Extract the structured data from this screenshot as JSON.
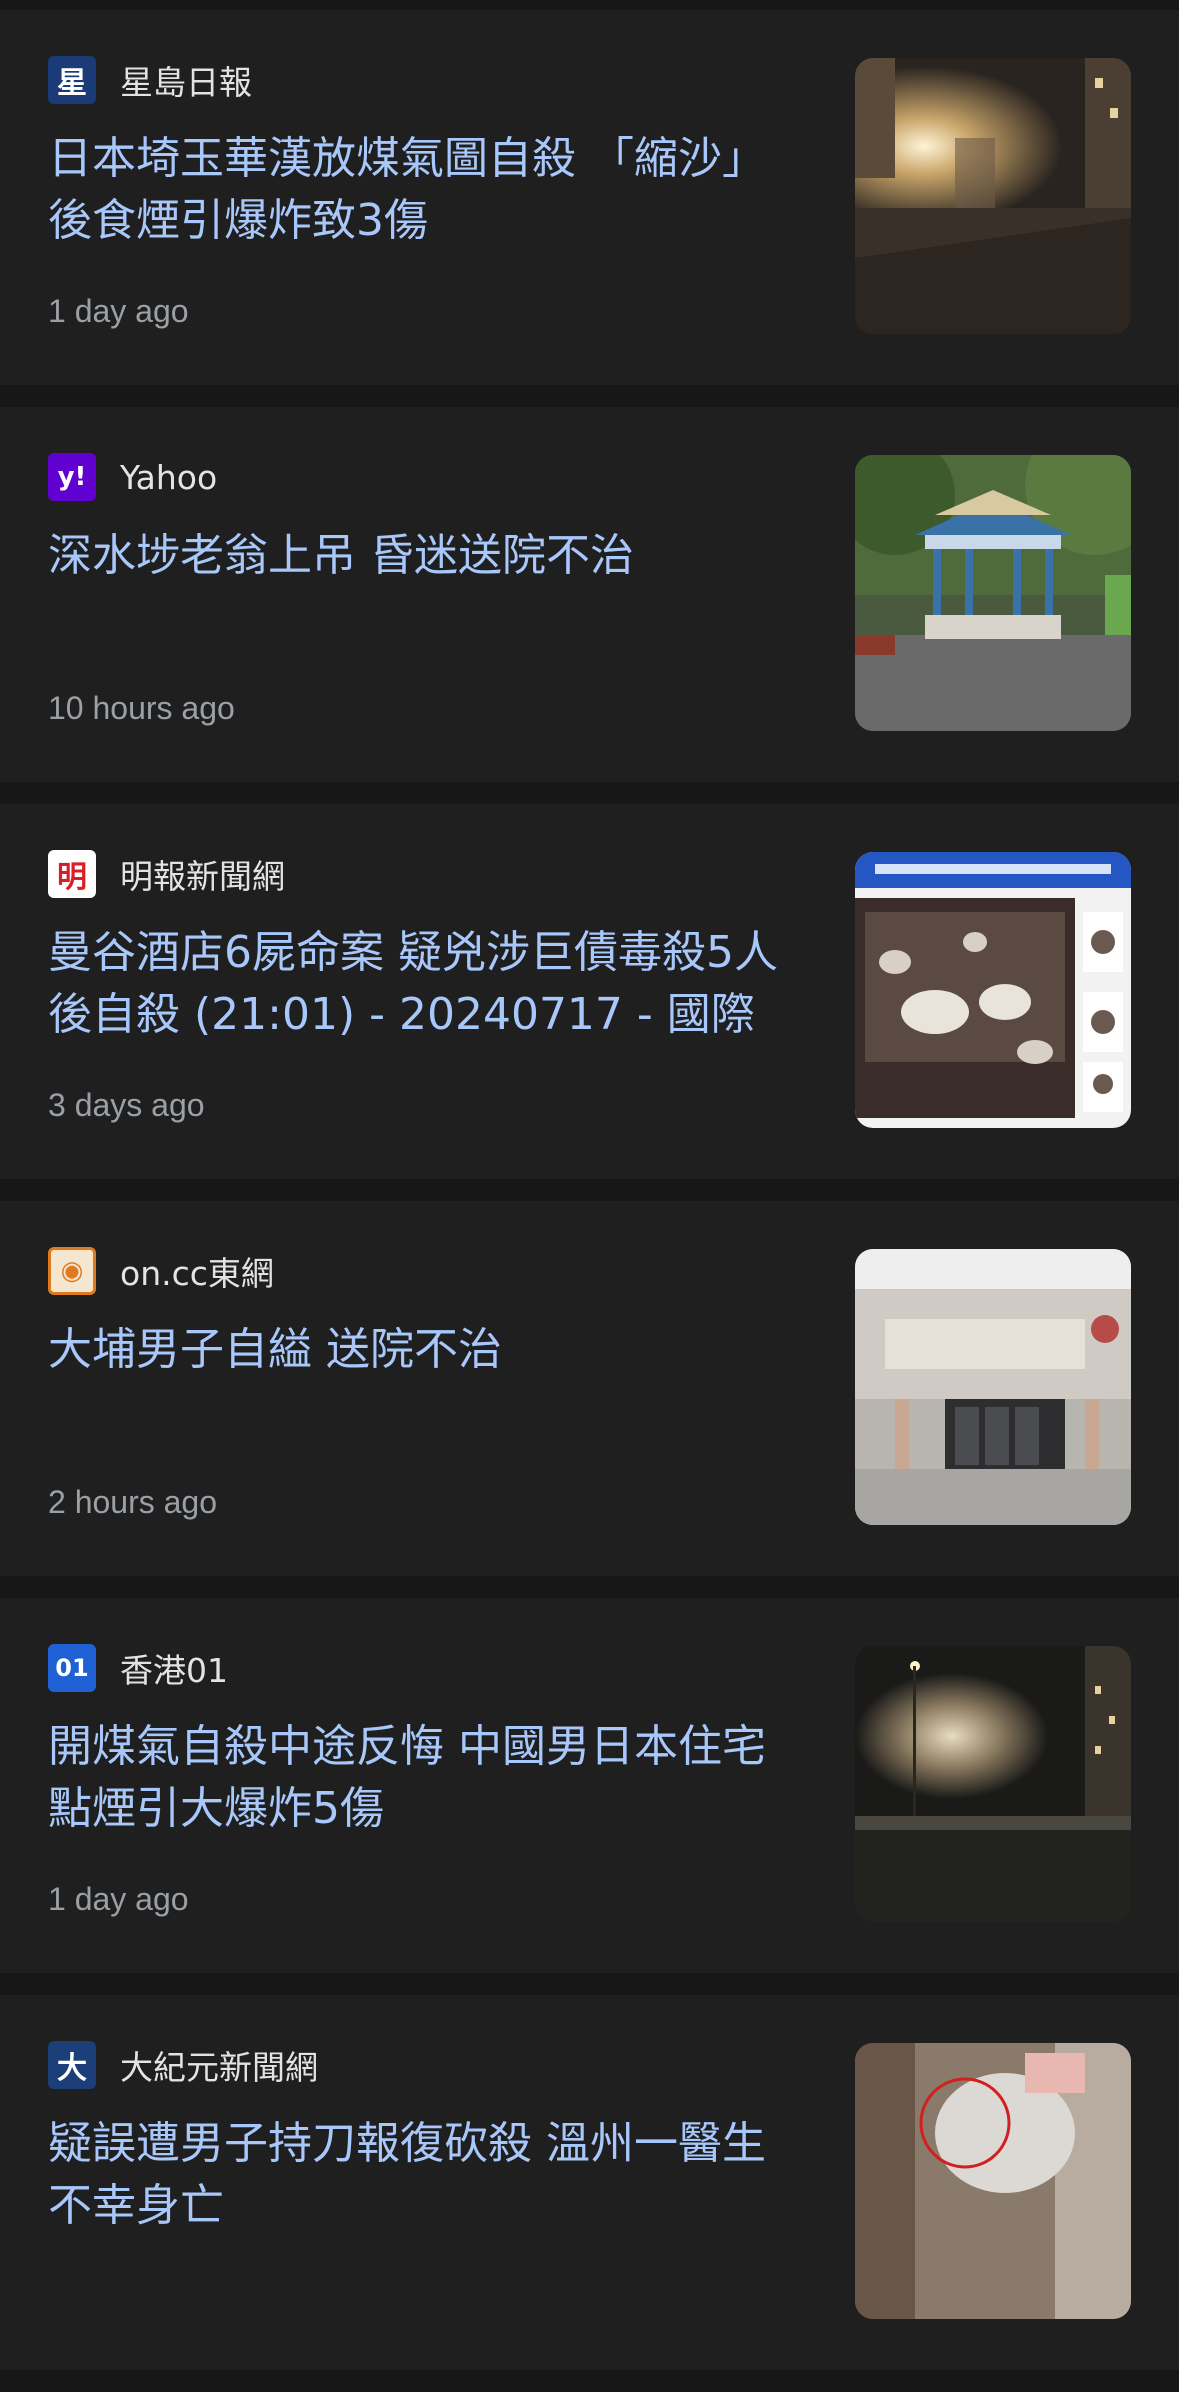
{
  "articles": [
    {
      "source": "星島日報",
      "source_icon": "singtao-logo-icon",
      "favicon_glyph": "星",
      "favicon_bg": "#1b3a78",
      "headline": "日本埼玉華漢放煤氣圖自殺 「縮沙」後食煙引爆炸致3傷",
      "time": "1 day ago",
      "thumbnail": "night-street-explosion-image"
    },
    {
      "source": "Yahoo",
      "source_icon": "yahoo-logo-icon",
      "favicon_glyph": "y!",
      "favicon_bg": "#6001d2",
      "headline": "深水埗老翁上吊 昏迷送院不治",
      "time": "10 hours ago",
      "thumbnail": "park-pavilion-image"
    },
    {
      "source": "明報新聞網",
      "source_icon": "mingpao-logo-icon",
      "favicon_glyph": "明",
      "favicon_bg": "#d61f26",
      "headline": "曼谷酒店6屍命案 疑兇涉巨債毒殺5人後自殺 (21:01) - 20240717 - 國際",
      "time": "3 days ago",
      "thumbnail": "hotel-table-evidence-image"
    },
    {
      "source": "on.cc東網",
      "source_icon": "oncc-logo-icon",
      "favicon_glyph": "◉",
      "favicon_bg": "#f5e6cf",
      "headline": "大埔男子自縊 送院不治",
      "time": "2 hours ago",
      "thumbnail": "hospital-entrance-image"
    },
    {
      "source": "香港01",
      "source_icon": "hk01-logo-icon",
      "favicon_glyph": "01",
      "favicon_bg": "#1f61d4",
      "headline": "開煤氣自殺中途反悔 中國男日本住宅點煙引大爆炸5傷",
      "time": "1 day ago",
      "thumbnail": "night-building-explosion-image"
    },
    {
      "source": "大紀元新聞網",
      "source_icon": "epochtimes-logo-icon",
      "favicon_glyph": "大",
      "favicon_bg": "#1c3f7a",
      "headline": "疑誤遭男子持刀報復砍殺 溫州一醫生不幸身亡",
      "time": "",
      "thumbnail": "cctv-still-image"
    }
  ]
}
